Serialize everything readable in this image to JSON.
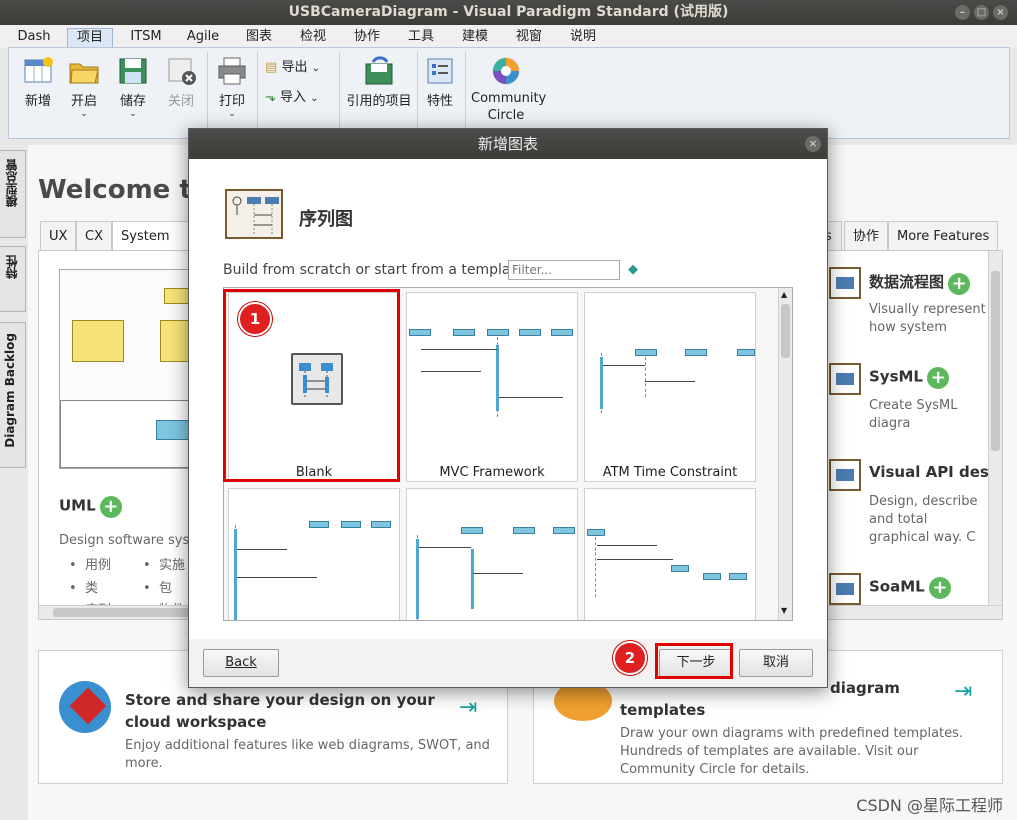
{
  "window": {
    "title": "USBCameraDiagram - Visual Paradigm Standard (试用版)"
  },
  "menu": {
    "tabs": [
      "Dash",
      "项目",
      "ITSM",
      "Agile",
      "图表",
      "检视",
      "协作",
      "工具",
      "建模",
      "视窗",
      "说明"
    ],
    "active": "项目"
  },
  "ribbon": {
    "new": "新增",
    "open": "开启",
    "save": "储存",
    "close": "关闭",
    "print": "打印",
    "export": "导出",
    "import": "导入",
    "referenced": "引用的项目",
    "properties": "特性",
    "community": "Community Circle"
  },
  "sidebar": {
    "model_explorer": "模型总管",
    "properties": "特性",
    "backlog": "Diagram Backlog"
  },
  "welcome": {
    "title": "Welcome to Visual Paradigm",
    "tabs_left": [
      "UX",
      "CX",
      "System Design"
    ],
    "tabs_right": [
      "s",
      "协作",
      "More Features"
    ],
    "uml": {
      "title": "UML",
      "desc": "Design software system",
      "items": [
        "用例",
        "实施",
        "类",
        "包",
        "序列",
        "物件"
      ]
    },
    "right_features": [
      {
        "title": "数据流程图",
        "desc": "Visually represent how system processes wi"
      },
      {
        "title": "SysML",
        "desc": "Create SysML diagra applications."
      },
      {
        "title": "Visual API design",
        "desc": "Design, describe and total graphical way. C applications."
      },
      {
        "title": "SoaML",
        "desc": ""
      }
    ],
    "cloud": {
      "title": "Store and share your design on your cloud workspace",
      "desc": "Enjoy additional features like web diagrams, SWOT, and more."
    },
    "templates": {
      "title": "diagram templates",
      "desc": "Draw your own diagrams with predefined templates. Hundreds of templates are available. Visit our Community Circle for details."
    }
  },
  "dialog": {
    "title": "新增图表",
    "diagram_type": "序列图",
    "prompt": "Build from scratch or start from a template",
    "filter_placeholder": "Filter...",
    "templates": [
      "Blank",
      "MVC Framework",
      "ATM Time Constraint",
      "",
      "",
      ""
    ],
    "back": "Back",
    "next": "下一步",
    "cancel": "取消"
  },
  "annotations": {
    "step1": "1",
    "step2": "2"
  },
  "watermark": "CSDN @星际工程师",
  "colors": {
    "highlight": "#e00000",
    "accent_green": "#5cb85c",
    "lifeline_blue": "#7ec6e0"
  }
}
